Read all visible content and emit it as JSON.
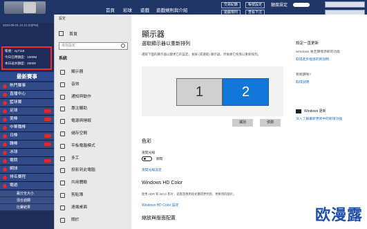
{
  "site": {
    "nav": [
      "首頁",
      "彩球",
      "遊戲",
      "遊戲規則與介紹",
      "",
      ""
    ],
    "buttons": [
      "交易紀錄",
      "遊戲規則",
      "帳號設定",
      "查看下注"
    ],
    "header_text": "額度設定",
    "header_text2": "",
    "time": "2020-09-01 21:21:23(PM)",
    "user": {
      "line1": "帳號：xy7118",
      "line2": "今日已用額度：1000M",
      "line3": "本日返水額度：20000"
    },
    "sidebar_heading": "最新賽事",
    "menu": [
      "熱門賽事",
      "直播中心",
      "籃球賽",
      "足球",
      "美棒",
      "中華職棒",
      "日棒",
      "韓棒",
      "冰球",
      "電競",
      "網球",
      "排名賽程",
      "電遊"
    ],
    "sub_items": [
      "贏分全大小",
      "混合過關",
      "比賽結果"
    ]
  },
  "window": {
    "title": "設定",
    "home": "首頁",
    "search_placeholder": "尋找設定",
    "system_label": "系統",
    "nav": [
      "顯示器",
      "音效",
      "通知與動作",
      "專注輔助",
      "電源與睡眠",
      "儲存空間",
      "平板電腦模式",
      "多工",
      "投影到此電腦",
      "共用體驗",
      "剪貼簿",
      "遠端桌面",
      "關於"
    ]
  },
  "main": {
    "title": "顯示器",
    "arrange_heading": "選取顯示器以重新排列",
    "arrange_desc": "選取下面的顯示器以變更它的設定。長按 (或選取) 顯示器，然後將它拖曳以重新排列。",
    "monitors": [
      "1",
      "2"
    ],
    "identify": "識別",
    "detect": "偵測",
    "color_heading": "色彩",
    "night_label": "夜間光線",
    "night_state": "關閉",
    "night_settings_link": "夜間光線設定",
    "hdr_heading": "Windows HD Color",
    "hdr_desc": "使用 HDR 和 WCG 影片、遊戲及應用程式獲得更明亮、更鮮明的圖片。",
    "hdr_link": "Windows HD Color 設定",
    "scale_heading": "縮放與版面配置"
  },
  "related": {
    "title": "設定一直更新",
    "text1": "Windows 會定期增添新的功能",
    "link1": "取得進步能感的新說明",
    "text2": "有問題嗎?",
    "link2": "取得說明",
    "update_label": "Windows 更新",
    "link3": "深入了解最新更新中的新增功能"
  },
  "watermark": "欧漫露"
}
